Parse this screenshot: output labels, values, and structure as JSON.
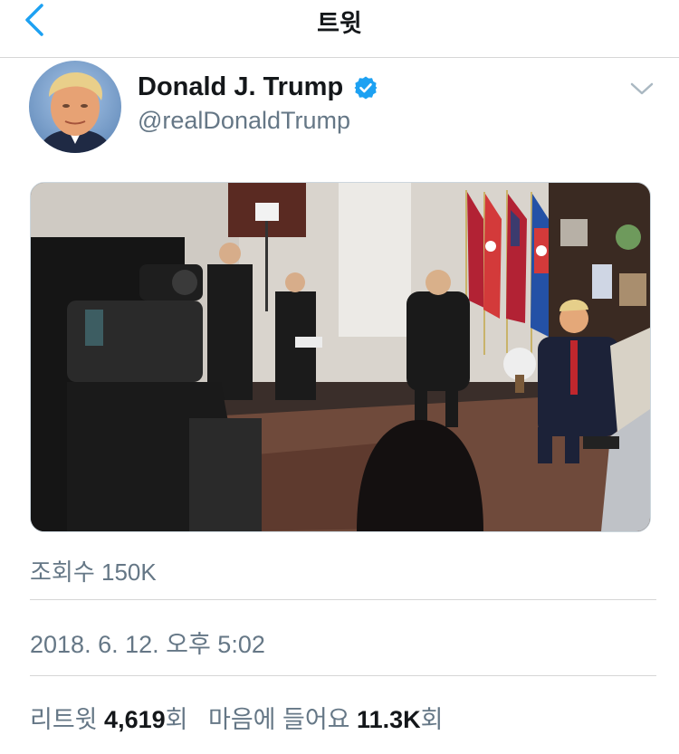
{
  "header": {
    "title": "트윗"
  },
  "tweet": {
    "author_name": "Donald J. Trump",
    "author_handle": "@realDonaldTrump",
    "views_label": "조회수 150K",
    "timestamp": "2018. 6. 12. 오후 5:02",
    "retweet_label": "리트윗",
    "retweet_count": "4,619",
    "count_suffix": "회",
    "like_label": "마음에 들어요",
    "like_count": "11.3K"
  },
  "colors": {
    "accent": "#1da1f2",
    "secondary_text": "#657786",
    "primary_text": "#14171a",
    "divider": "#d6d6d6"
  },
  "icons": {
    "back": "back-chevron-icon",
    "verified": "verified-badge-icon",
    "menu": "chevron-down-icon"
  }
}
